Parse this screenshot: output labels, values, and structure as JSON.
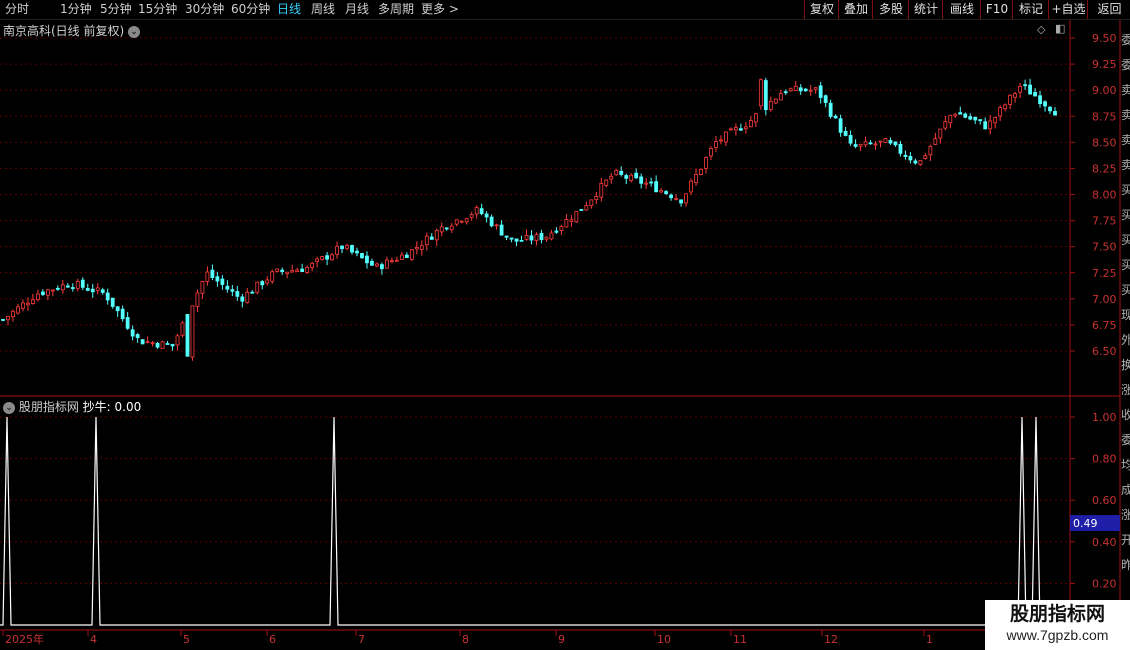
{
  "toolbar": {
    "left": [
      "分时",
      "1分钟",
      "5分钟",
      "15分钟",
      "30分钟",
      "60分钟",
      "日线",
      "周线",
      "月线",
      "多周期",
      "更多 >"
    ],
    "active": "日线",
    "right": [
      "复权",
      "叠加",
      "多股",
      "统计",
      "画线",
      "F10",
      "标记",
      "+自选",
      "返回"
    ]
  },
  "main_panel": {
    "title": "南京高科(日线 前复权)",
    "y_ticks": [
      "9.50",
      "9.25",
      "9.00",
      "8.75",
      "8.50",
      "8.25",
      "8.00",
      "7.75",
      "7.50",
      "7.25",
      "7.00",
      "6.75",
      "6.50"
    ]
  },
  "indicator_panel": {
    "title": "股朋指标网",
    "label": "抄牛: 0.00",
    "y_ticks": [
      "1.00",
      "0.80",
      "0.60",
      "0.40",
      "0.20"
    ],
    "cursor_value": "0.49"
  },
  "x_axis": {
    "labels": [
      "2025年",
      "4",
      "5",
      "6",
      "7",
      "8",
      "9",
      "10",
      "11",
      "12",
      "1"
    ]
  },
  "side_strip": {
    "chars": [
      "委",
      "委",
      "卖",
      "卖",
      "卖",
      "卖",
      "买",
      "买",
      "买",
      "买",
      "买",
      "现",
      "外",
      "换",
      "涨",
      "收",
      "委",
      "均",
      "成",
      "涨",
      "开",
      "昨"
    ]
  },
  "watermark": {
    "name": "股朋指标网",
    "url": "www.7gpzb.com"
  },
  "colors": {
    "up": "#ff3c3c",
    "down": "#54ffff",
    "grid": "#5a0000",
    "border": "#a01010",
    "signal": "#ffffff",
    "axis_text": "#c83232"
  },
  "chart_data": [
    {
      "type": "candlestick",
      "title": "南京高科(日线 前复权)",
      "y_range": [
        6.25,
        9.6
      ],
      "x_labels": [
        "2025年",
        "4",
        "5",
        "6",
        "7",
        "8",
        "9",
        "10",
        "11",
        "12",
        "1"
      ],
      "close_approx": [
        6.8,
        7.05,
        7.15,
        7.05,
        6.6,
        6.55,
        7.25,
        7.0,
        7.25,
        7.3,
        7.5,
        7.3,
        7.45,
        7.7,
        7.85,
        7.55,
        7.6,
        7.85,
        8.2,
        8.1,
        7.95,
        8.5,
        8.7,
        9.0,
        9.0,
        8.45,
        8.5,
        8.3,
        8.8,
        8.65,
        9.05,
        8.8
      ],
      "ohlc_sample": [
        {
          "o": 6.95,
          "h": 7.05,
          "l": 6.75,
          "c": 6.8
        },
        {
          "o": 7.0,
          "h": 7.2,
          "l": 6.95,
          "c": 7.15
        },
        {
          "o": 7.1,
          "h": 7.15,
          "l": 7.0,
          "c": 7.05
        },
        {
          "o": 6.8,
          "h": 6.85,
          "l": 6.3,
          "c": 6.55
        },
        {
          "o": 6.55,
          "h": 7.3,
          "l": 6.55,
          "c": 7.25
        },
        {
          "o": 7.3,
          "h": 7.35,
          "l": 7.15,
          "c": 7.25
        },
        {
          "o": 7.4,
          "h": 7.55,
          "l": 7.2,
          "c": 7.45
        },
        {
          "o": 7.7,
          "h": 7.85,
          "l": 7.55,
          "c": 7.6
        },
        {
          "o": 8.2,
          "h": 8.3,
          "l": 7.9,
          "c": 8.05
        },
        {
          "o": 8.4,
          "h": 8.55,
          "l": 8.2,
          "c": 8.45
        },
        {
          "o": 8.7,
          "h": 9.45,
          "l": 8.65,
          "c": 9.05
        },
        {
          "o": 8.95,
          "h": 9.1,
          "l": 8.4,
          "c": 8.5
        },
        {
          "o": 8.5,
          "h": 8.6,
          "l": 8.1,
          "c": 8.2
        },
        {
          "o": 8.6,
          "h": 8.95,
          "l": 8.5,
          "c": 8.85
        },
        {
          "o": 8.9,
          "h": 9.2,
          "l": 8.6,
          "c": 9.0
        }
      ]
    },
    {
      "type": "line",
      "title": "股朋指标网 抄牛",
      "y_range": [
        0,
        1.0
      ],
      "signals": [
        {
          "at": "2025-03 start",
          "value": 1
        },
        {
          "at": "2025-04 start",
          "value": 1
        },
        {
          "at": "2025-06 end",
          "value": 1
        },
        {
          "at": "2026-01",
          "value": 1
        },
        {
          "at": "2026-01",
          "value": 1
        }
      ],
      "baseline": 0
    }
  ]
}
